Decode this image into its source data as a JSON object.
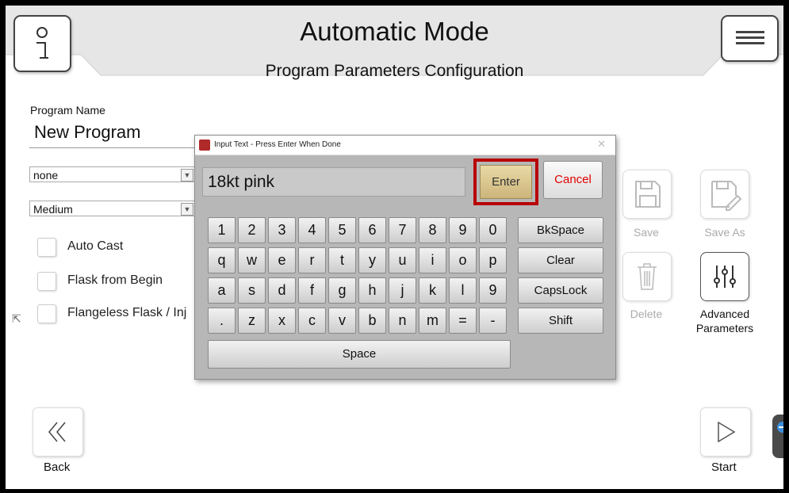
{
  "header": {
    "title": "Automatic Mode",
    "subtitle": "Program Parameters Configuration"
  },
  "form": {
    "program_name_label": "Program Name",
    "program_name_value": "New Program",
    "select1_value": "none",
    "select2_value": "Medium",
    "checkboxes": [
      {
        "label": "Auto Cast",
        "checked": false
      },
      {
        "label": "Flask from Begin",
        "checked": false
      },
      {
        "label": "Flangeless Flask / Inj",
        "checked": false
      }
    ]
  },
  "actions": {
    "save": "Save",
    "save_as": "Save As",
    "delete": "Delete",
    "advanced_line1": "Advanced",
    "advanced_line2": "Parameters"
  },
  "nav": {
    "back": "Back",
    "start": "Start"
  },
  "dialog": {
    "title": "Input Text  -  Press Enter When Done",
    "close": "✕",
    "input_value": "18kt pink",
    "enter": "Enter",
    "cancel": "Cancel",
    "rows": [
      [
        "1",
        "2",
        "3",
        "4",
        "5",
        "6",
        "7",
        "8",
        "9",
        "0"
      ],
      [
        "q",
        "w",
        "e",
        "r",
        "t",
        "y",
        "u",
        "i",
        "o",
        "p"
      ],
      [
        "a",
        "s",
        "d",
        "f",
        "g",
        "h",
        "j",
        "k",
        "l",
        "9"
      ],
      [
        ".",
        "z",
        "x",
        "c",
        "v",
        "b",
        "n",
        "m",
        "=",
        "-"
      ]
    ],
    "side_keys": [
      "BkSpace",
      "Clear",
      "CapsLock",
      "Shift"
    ],
    "space": "Space"
  }
}
